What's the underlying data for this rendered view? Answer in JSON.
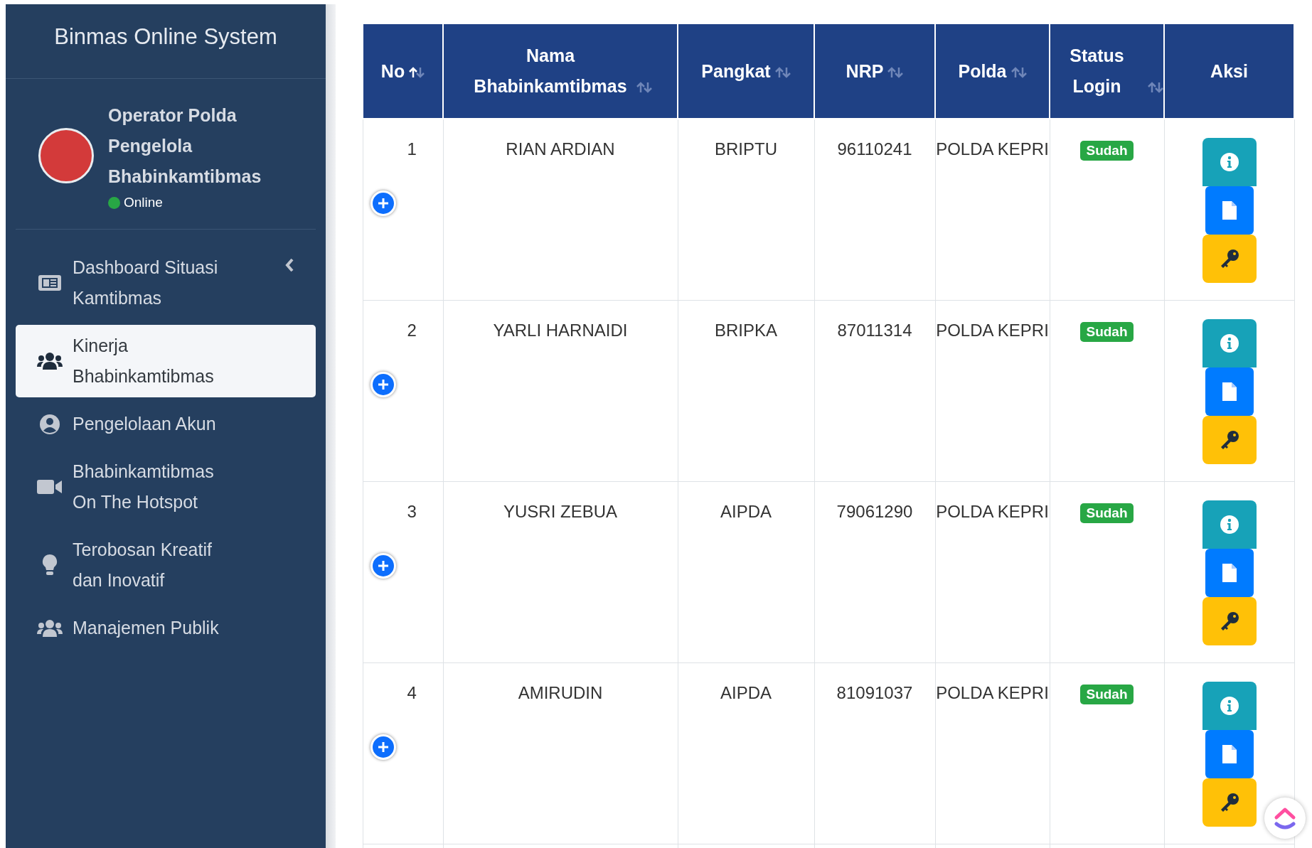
{
  "sidebar": {
    "brand": "Binmas Online System",
    "user": {
      "name_lines": [
        "Operator Polda",
        "Pengelola",
        "Bhabinkamtibmas"
      ],
      "status": "Online",
      "online": true
    },
    "items": [
      {
        "label": "Dashboard Situasi Kamtibmas",
        "kind": "tree",
        "expanded": false,
        "selected": false
      },
      {
        "label": "Kinerja Bhabinkamtibmas",
        "kind": "link",
        "selected": true
      },
      {
        "label": "Pengelolaan Akun",
        "kind": "link",
        "selected": false
      },
      {
        "label": "Bhabinkamtibmas On The Hotspot",
        "kind": "link",
        "selected": false
      },
      {
        "label": "Terobosan Kreatif dan Inovatif",
        "kind": "link",
        "selected": false
      },
      {
        "label": "Manajemen Publik",
        "kind": "link",
        "selected": false
      }
    ]
  },
  "table": {
    "columns": [
      {
        "label": "No",
        "sorted_ascending": true
      },
      {
        "label": "Nama Bhabinkamtibmas",
        "sorted_ascending": false
      },
      {
        "label": "Pangkat",
        "sorted_ascending": false
      },
      {
        "label": "NRP",
        "sorted_ascending": false
      },
      {
        "label": "Polda",
        "sorted_ascending": false
      },
      {
        "label": "Status Login",
        "sorted_ascending": false
      },
      {
        "label": "Aksi"
      }
    ],
    "rows": [
      {
        "no": "1",
        "nama": "RIAN ARDIAN",
        "pangkat": "BRIPTU",
        "nrp": "96110241",
        "polda": "POLDA KEPRI",
        "status": "Sudah"
      },
      {
        "no": "2",
        "nama": "YARLI HARNAIDI",
        "pangkat": "BRIPKA",
        "nrp": "87011314",
        "polda": "POLDA KEPRI",
        "status": "Sudah"
      },
      {
        "no": "3",
        "nama": "YUSRI ZEBUA",
        "pangkat": "AIPDA",
        "nrp": "79061290",
        "polda": "POLDA KEPRI",
        "status": "Sudah"
      },
      {
        "no": "4",
        "nama": "AMIRUDIN",
        "pangkat": "AIPDA",
        "nrp": "81091037",
        "polda": "POLDA KEPRI",
        "status": "Sudah"
      }
    ]
  }
}
